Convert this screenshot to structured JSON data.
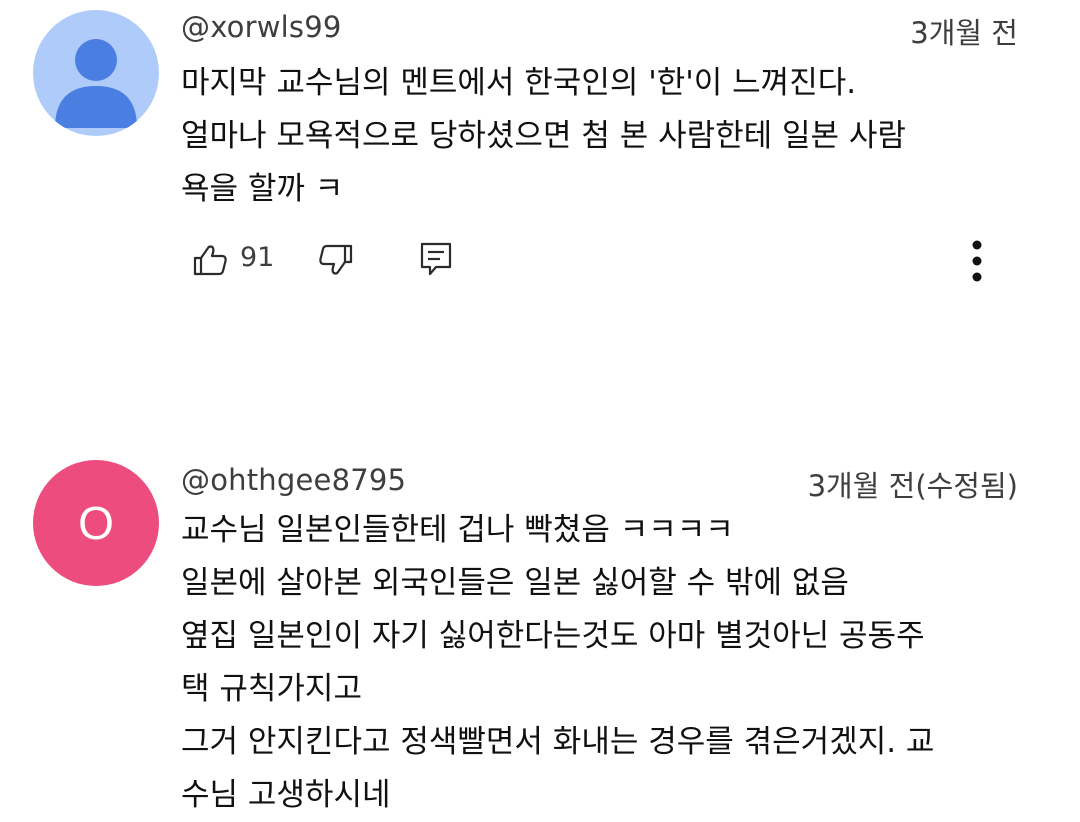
{
  "comments": [
    {
      "avatar": {
        "type": "default-person",
        "background_color": "#aecbfa",
        "icon_color": "#4a7ee0"
      },
      "author": "@xorwls99",
      "timestamp": "3개월 전",
      "lines": [
        "마지막 교수님의 멘트에서 한국인의 '한'이 느껴진다.",
        "얼마나 모욕적으로 당하셨으면 첨 본 사람한테 일본 사람",
        "욕을 할까 ㅋ"
      ],
      "like_count": "91",
      "icons": {
        "like": "thumbs-up-icon",
        "dislike": "thumbs-down-icon",
        "reply": "reply-icon",
        "more": "more-vertical-icon"
      }
    },
    {
      "avatar": {
        "type": "letter",
        "letter": "O",
        "background_color": "#ec4c7e"
      },
      "author": "@ohthgee8795",
      "timestamp": "3개월 전(수정됨)",
      "lines": [
        "교수님 일본인들한테 겁나 빡쳤음 ㅋㅋㅋㅋ",
        "일본에 살아본 외국인들은 일본 싫어할 수 밖에 없음",
        "옆집 일본인이 자기 싫어한다는것도 아마 별것아닌 공동주",
        "택 규칙가지고",
        "그거 안지킨다고 정색빨면서 화내는 경우를 겪은거겠지. 교",
        "수님 고생하시네"
      ]
    }
  ]
}
